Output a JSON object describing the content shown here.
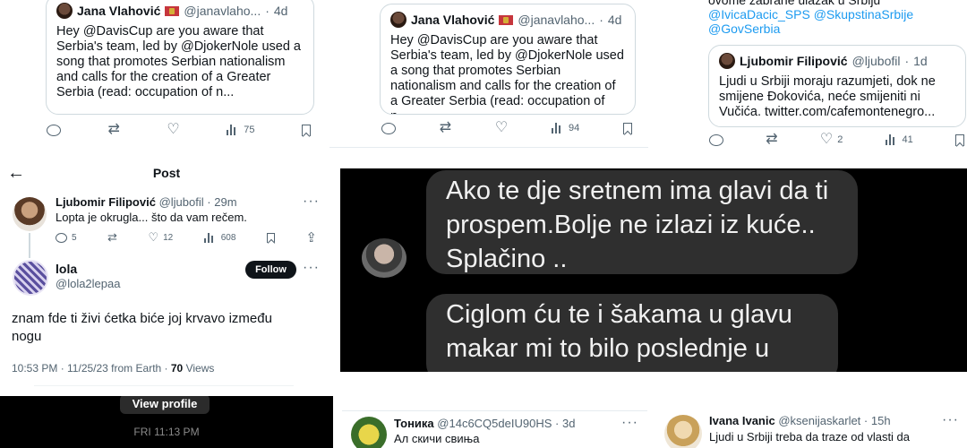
{
  "panel1": {
    "name": "Jana Vlahović",
    "handle": "@janavlaho...",
    "age": "4d",
    "text": "Hey @DavisCup are you aware that Serbia's team, led by @DjokerNole used a song that promotes Serbian nationalism and calls for the creation of a Greater Serbia (read: occupation of n...",
    "views": "75"
  },
  "panel2": {
    "name": "Jana Vlahović",
    "handle": "@janavlaho...",
    "age": "4d",
    "text": "Hey @DavisCup are you aware that Serbia's team, led by @DjokerNole used a song that promotes Serbian nationalism and calls for the creation of a Greater Serbia (read: occupation of n...",
    "views": "94"
  },
  "panel3": {
    "top_line": "ovome zabrane ulazak u Srbiju",
    "mentions_1": "@IvicaDacic_SPS @SkupstinaSrbije",
    "mentions_2": "@GovSerbia",
    "quote_name": "Ljubomir Filipović",
    "quote_handle": "@ljubofil",
    "quote_age": "1d",
    "quote_text": "Ljudi u Srbiji moraju razumjeti, dok ne smijene Đokovića, neće smijeniti ni Vučića. twitter.com/cafemontenegro...",
    "likes": "2",
    "views": "41"
  },
  "panel4": {
    "header": "Post",
    "reply": {
      "name": "Ljubomir Filipović",
      "handle": "@ljubofil",
      "age": "29m",
      "text": "Lopta je okrugla... što da vam rečem.",
      "replies": "5",
      "likes": "12",
      "views": "608"
    },
    "main": {
      "name": "lola",
      "handle": "@lola2lepaa",
      "follow": "Follow",
      "text": "znam fde ti živi ćetka biće joj krvavo između nogu",
      "time": "10:53 PM · 11/25/23 from Earth · ",
      "views_count": "70",
      "views_label": " Views"
    }
  },
  "panel5": {
    "button": "View profile",
    "timestamp": "FRI 11:13 PM"
  },
  "panel6": {
    "bubble1": "Ako te dje sretnem ima glavi da ti prospem.Bolje ne izlazi iz kuće.. Splačino ..",
    "bubble2": "Ciglom ću te i šakama u glavu makar mi to bilo poslednje u"
  },
  "panel7": {
    "name": "Тоника",
    "handle": "@14c6CQ5deIU90HS",
    "age": "3d",
    "text": "Ал скичи свиња"
  },
  "panel8": {
    "name": "Ivana Ivanic",
    "handle": "@ksenijaskarlet",
    "age": "15h",
    "text": "Ljudi u Srbiji treba da traze od vlasti da"
  }
}
